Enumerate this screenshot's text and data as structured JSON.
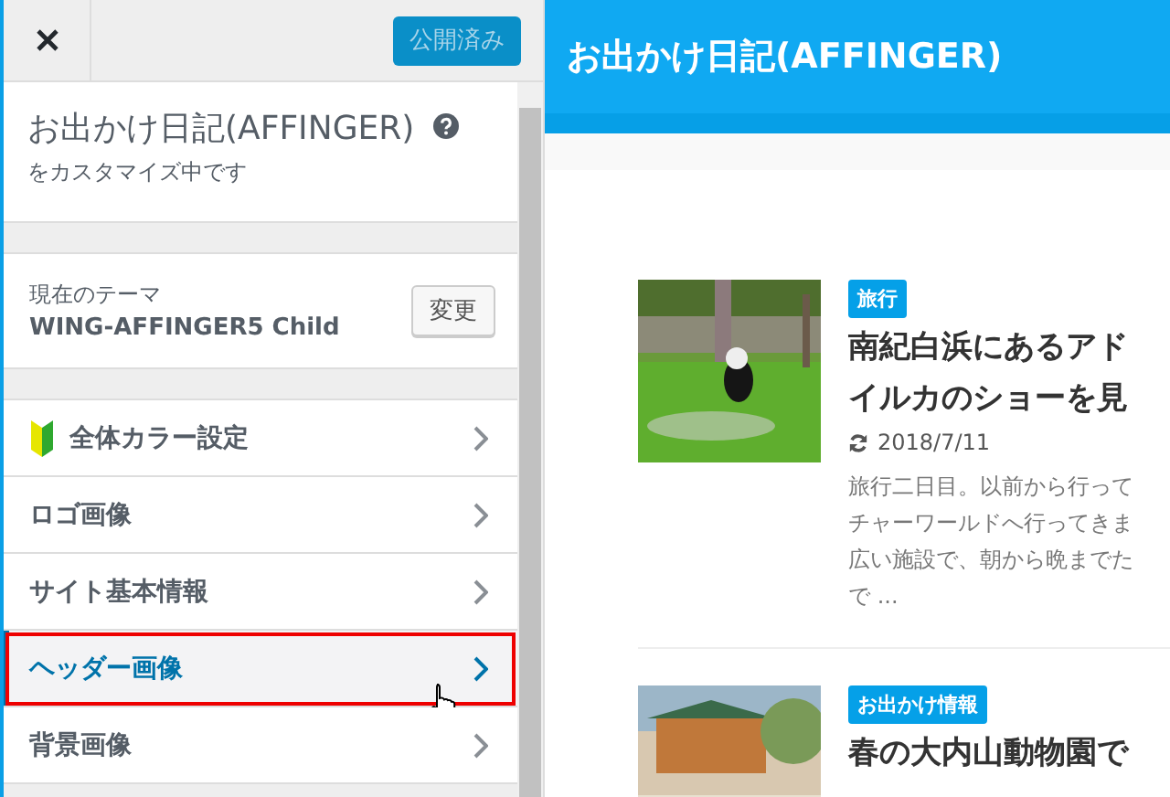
{
  "customizer": {
    "publish_button": {
      "label": "公開済み",
      "disabled": true
    },
    "site_title": "お出かけ日記(AFFINGER)",
    "subtitle": "をカスタマイズ中です",
    "theme": {
      "label": "現在のテーマ",
      "name": "WING-AFFINGER5 Child",
      "button": "変更"
    },
    "menu": [
      {
        "label": "全体カラー設定",
        "kind": "beginner",
        "selected": false
      },
      {
        "label": "ロゴ画像",
        "kind": "plain",
        "selected": false
      },
      {
        "label": "サイト基本情報",
        "kind": "plain",
        "selected": false
      },
      {
        "label": "ヘッダー画像",
        "kind": "plain",
        "selected": true
      },
      {
        "label": "背景画像",
        "kind": "plain",
        "selected": false
      }
    ]
  },
  "preview": {
    "site_title": "お出かけ日記(AFFINGER)",
    "posts": [
      {
        "tag": "旅行",
        "title_lines": [
          "南紀白浜にあるアド",
          "イルカのショーを見"
        ],
        "date": "2018/7/11",
        "excerpt_lines": [
          "旅行二日目。以前から行って",
          "チャーワールドへ行ってきま",
          "広い施設で、朝から晩までた",
          "で ..."
        ]
      },
      {
        "tag": "お出かけ情報",
        "title_lines": [
          "春の大内山動物園で"
        ]
      }
    ]
  }
}
